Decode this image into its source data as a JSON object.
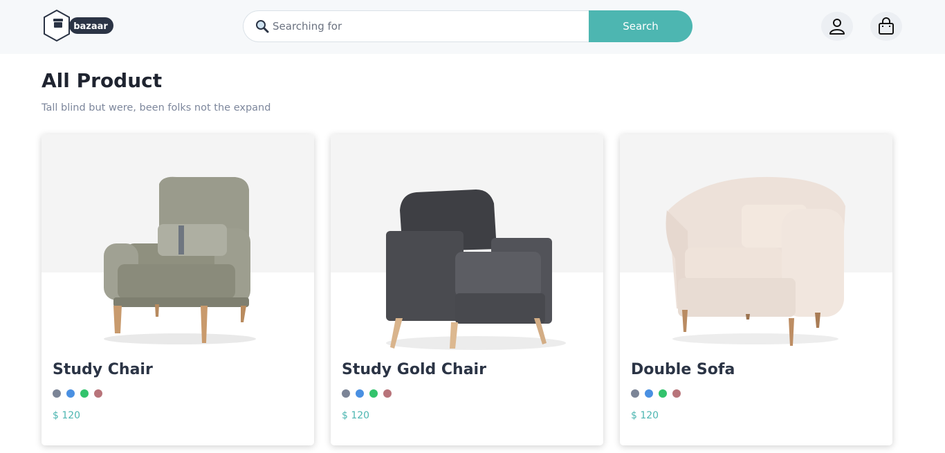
{
  "header": {
    "logo_text": "bazaar",
    "search": {
      "placeholder": "Searching for",
      "value": "",
      "button_label": "Search"
    },
    "icons": {
      "user": "user-icon",
      "cart": "shopping-bag-icon",
      "search": "search-icon"
    }
  },
  "main": {
    "title": "All Product",
    "subtitle": "Tall blind but were, been folks not the expand"
  },
  "colors": {
    "accent": "#4db6b1",
    "swatches": [
      "#7b8496",
      "#4a90e2",
      "#32c36c",
      "#b8747a"
    ]
  },
  "products": [
    {
      "name": "Study Chair",
      "price": "$ 120",
      "image": "armchair-image"
    },
    {
      "name": "Study Gold Chair",
      "price": "$ 120",
      "image": "armchair-image"
    },
    {
      "name": "Double Sofa",
      "price": "$ 120",
      "image": "tub-chair-image"
    }
  ]
}
